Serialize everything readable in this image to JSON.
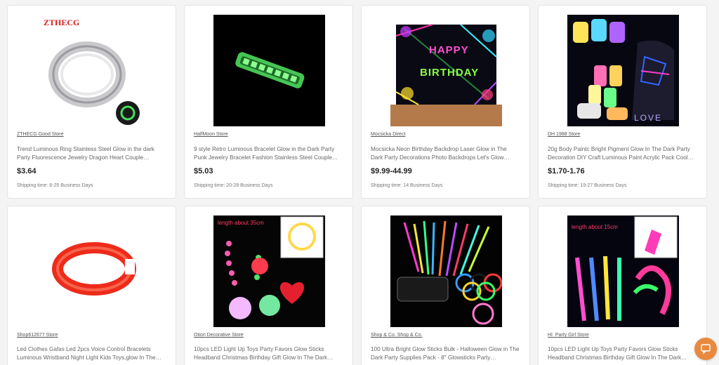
{
  "products": [
    {
      "store": "ZTHECG Good Store",
      "title": "Trend Luminous Ring Stainless Steel Glow in the dark Party Fluorescence Jewelry Dragon Heart Couple…",
      "price": "$3.64",
      "shipping": "Shipping time: 8-25 Business Days",
      "image_brand": "ZTHECG",
      "image_icon": "ring-icon"
    },
    {
      "store": "HalfMoon Store",
      "title": "9 style Retro Luminous Bracelet Glow in the Dark Party Punk Jewelry Bracelet Fashion Stainless Steel Couple…",
      "price": "$5.03",
      "shipping": "Shipping time: 20-28 Business Days",
      "image_icon": "bracelet-icon"
    },
    {
      "store": "Mocsicka Direct",
      "title": "Mocsicka Neon Birthday Backdrop Laser Glow in The Dark Party Decorations Photo Backdrops Let's Glow…",
      "price": "$9.99-44.99",
      "shipping": "Shipping time: 14 Business Days",
      "image_text_1": "HAPPY",
      "image_text_2": "BIRTHDAY",
      "image_icon": "backdrop-icon"
    },
    {
      "store": "DH 1988 Store",
      "title": "20g Body Paintc Bright Pigment Glow In The Dark Party Decoration DIY Craft Luminous Paint Acrylic Pack Cool…",
      "price": "$1.70-1.76",
      "shipping": "Shipping time: 19-27 Business Days",
      "image_text": "LOVE",
      "image_icon": "paint-jars-icon"
    },
    {
      "store": "Shop612677 Store",
      "title": "Led Clothes Gafas Led 2pcs Voice Control Bracelets Luminous Wristband Night Light Kids Toys,glow In The…",
      "image_icon": "led-bracelet-icon"
    },
    {
      "store": "Otion Decorative Store",
      "title": "10pcs LED Light Up Toys Party Favors Glow Sticks Headband Christmas Birthday Gift Glow In The Dark…",
      "image_text": "length about 35cm",
      "image_icon": "necklaces-icon"
    },
    {
      "store": "Shop & Co. Shop & Co.",
      "title": "100 Ultra Bright Glow Sticks Bulk - Halloween Glow in The Dark Party Supplies Pack - 8\" Glowsticks Party…",
      "image_icon": "glow-sticks-icon"
    },
    {
      "store": "HI_Party Girl Store",
      "title": "10pcs LED Light Up Toys Party Favors Glow Sticks Headband Christmas Birthday Gift Glow In The Dark…",
      "image_text": "length about 15cm",
      "image_icon": "slingshot-icon"
    }
  ],
  "chat": {
    "icon": "chat-icon",
    "color": "#e8893f"
  }
}
